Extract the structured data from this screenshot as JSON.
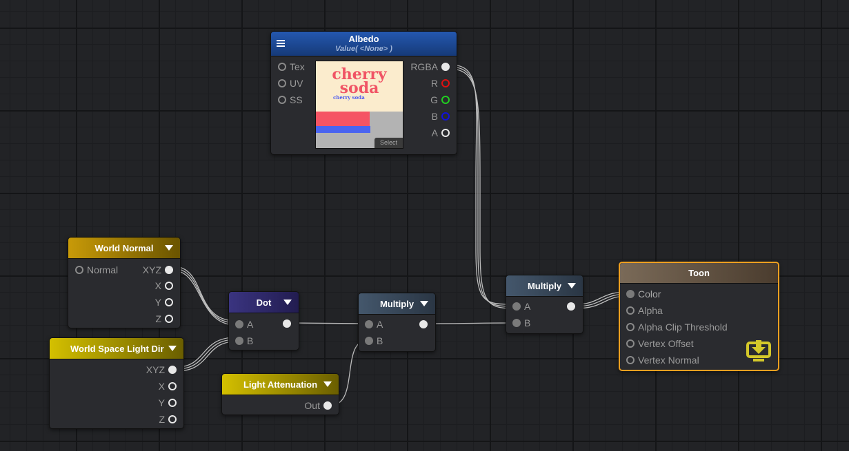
{
  "albedo": {
    "title": "Albedo",
    "subtitle": "Value( <None> )",
    "inputs": [
      "Tex",
      "UV",
      "SS"
    ],
    "outputs": [
      "RGBA",
      "R",
      "G",
      "B",
      "A"
    ],
    "preview_text": [
      "cherry",
      "soda"
    ],
    "preview_subtext": "cherry soda",
    "select_label": "Select"
  },
  "world_normal": {
    "title": "World Normal",
    "input": "Normal",
    "outputs": [
      "XYZ",
      "X",
      "Y",
      "Z"
    ]
  },
  "light_dir": {
    "title": "World Space Light Dir",
    "outputs": [
      "XYZ",
      "X",
      "Y",
      "Z"
    ]
  },
  "dot": {
    "title": "Dot",
    "inputs": [
      "A",
      "B"
    ]
  },
  "light_atten": {
    "title": "Light Attenuation",
    "output": "Out"
  },
  "multiply1": {
    "title": "Multiply",
    "inputs": [
      "A",
      "B"
    ]
  },
  "multiply2": {
    "title": "Multiply",
    "inputs": [
      "A",
      "B"
    ]
  },
  "toon": {
    "title": "Toon",
    "inputs": [
      "Color",
      "Alpha",
      "Alpha Clip Threshold",
      "Vertex Offset",
      "Vertex Normal"
    ]
  },
  "colors": {
    "accent": "#f0a020",
    "albedo_header": "#1e4fa0",
    "yellow_header": "#c8b400",
    "dot_header": "#3a3270",
    "multiply_header": "#3a4a5c",
    "toon_header": "#6e5e4a"
  }
}
